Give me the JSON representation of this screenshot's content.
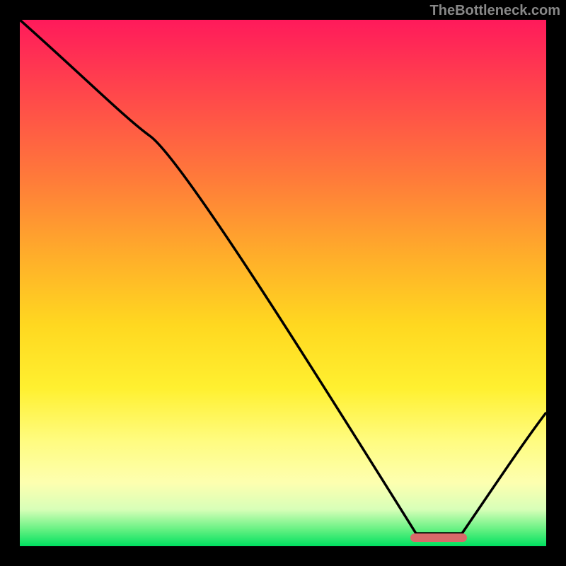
{
  "watermark": "TheBottleneck.com",
  "chart_data": {
    "type": "line",
    "title": "",
    "xlabel": "",
    "ylabel": "",
    "xlim": [
      0,
      100
    ],
    "ylim": [
      0,
      100
    ],
    "x": [
      0,
      25,
      78,
      85,
      100
    ],
    "values": [
      100,
      78,
      0,
      0,
      25
    ],
    "marker": {
      "x_start": 74,
      "x_end": 85,
      "y": 0
    },
    "background": "red-yellow-green vertical gradient"
  }
}
